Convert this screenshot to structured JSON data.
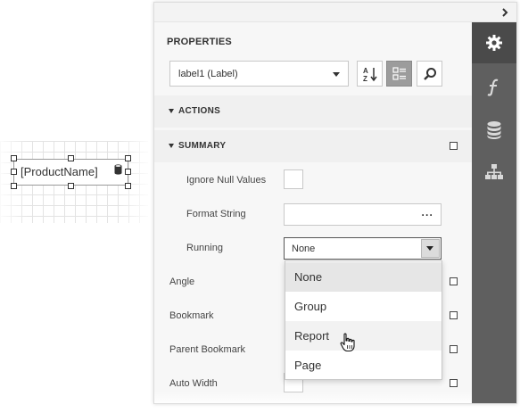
{
  "designer": {
    "label_text": "[ProductName]"
  },
  "panel": {
    "title": "PROPERTIES",
    "component_selector": "label1 (Label)",
    "tools": {
      "sort_icon": "az-sort-icon",
      "categorized_icon": "categorized-icon",
      "search_icon": "search-icon"
    },
    "side_tabs": [
      {
        "icon": "gear-icon",
        "active": true
      },
      {
        "icon": "function-icon",
        "active": false
      },
      {
        "icon": "database-icon",
        "active": false
      },
      {
        "icon": "hierarchy-icon",
        "active": false
      }
    ]
  },
  "sections": {
    "actions": "ACTIONS",
    "summary": "SUMMARY"
  },
  "summary_props": {
    "ignore_null_values": "Ignore Null Values",
    "format_string": "Format String",
    "format_string_ellipsis": "···",
    "running": "Running",
    "running_value": "None"
  },
  "other_props": {
    "angle": "Angle",
    "bookmark": "Bookmark",
    "parent_bookmark": "Parent Bookmark",
    "auto_width": "Auto Width"
  },
  "running_options": [
    "None",
    "Group",
    "Report",
    "Page"
  ],
  "colors": {
    "sidebar": "#5f5f5f",
    "sidebar_active": "#4a4a4a",
    "panel_bg": "#f7f7f7"
  }
}
